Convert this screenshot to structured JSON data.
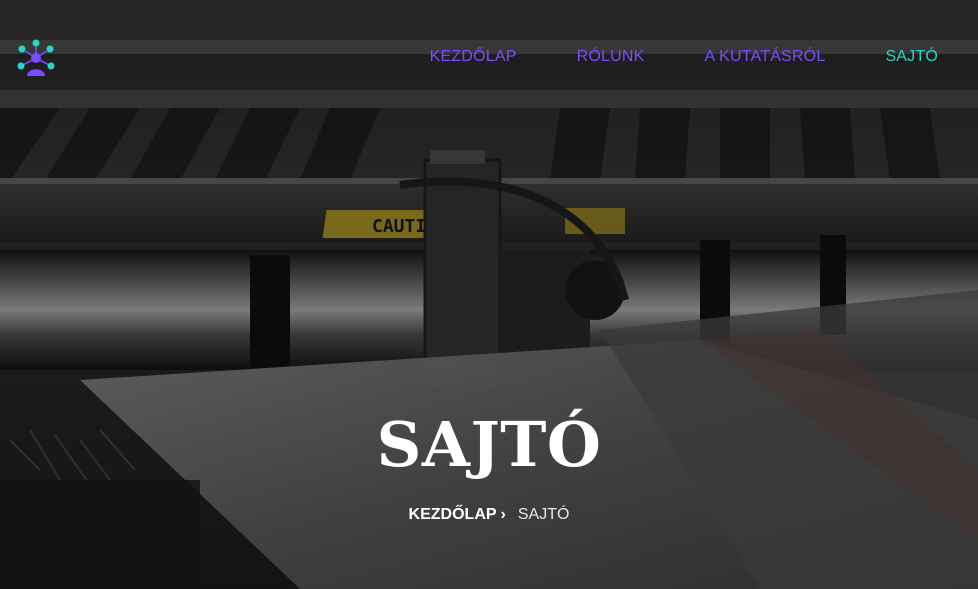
{
  "nav": {
    "items": [
      {
        "label": "KEZDŐLAP"
      },
      {
        "label": "RÓLUNK"
      },
      {
        "label": "A KUTATÁSRÓL"
      },
      {
        "label": "SAJTÓ"
      }
    ],
    "active_color": "#2ad6c6",
    "link_color": "#7b4dff"
  },
  "hero": {
    "title": "SAJTÓ",
    "caution_text": "CAUTION",
    "background": "printing-press-photo"
  },
  "breadcrumb": {
    "home_label": "KEZDŐLAP",
    "separator_icon": "chevron-right-icon",
    "current_label": "SAJTÓ"
  },
  "logo": {
    "icon": "network-people-logo-icon",
    "colors": [
      "#2ad6c6",
      "#7b4dff"
    ]
  }
}
